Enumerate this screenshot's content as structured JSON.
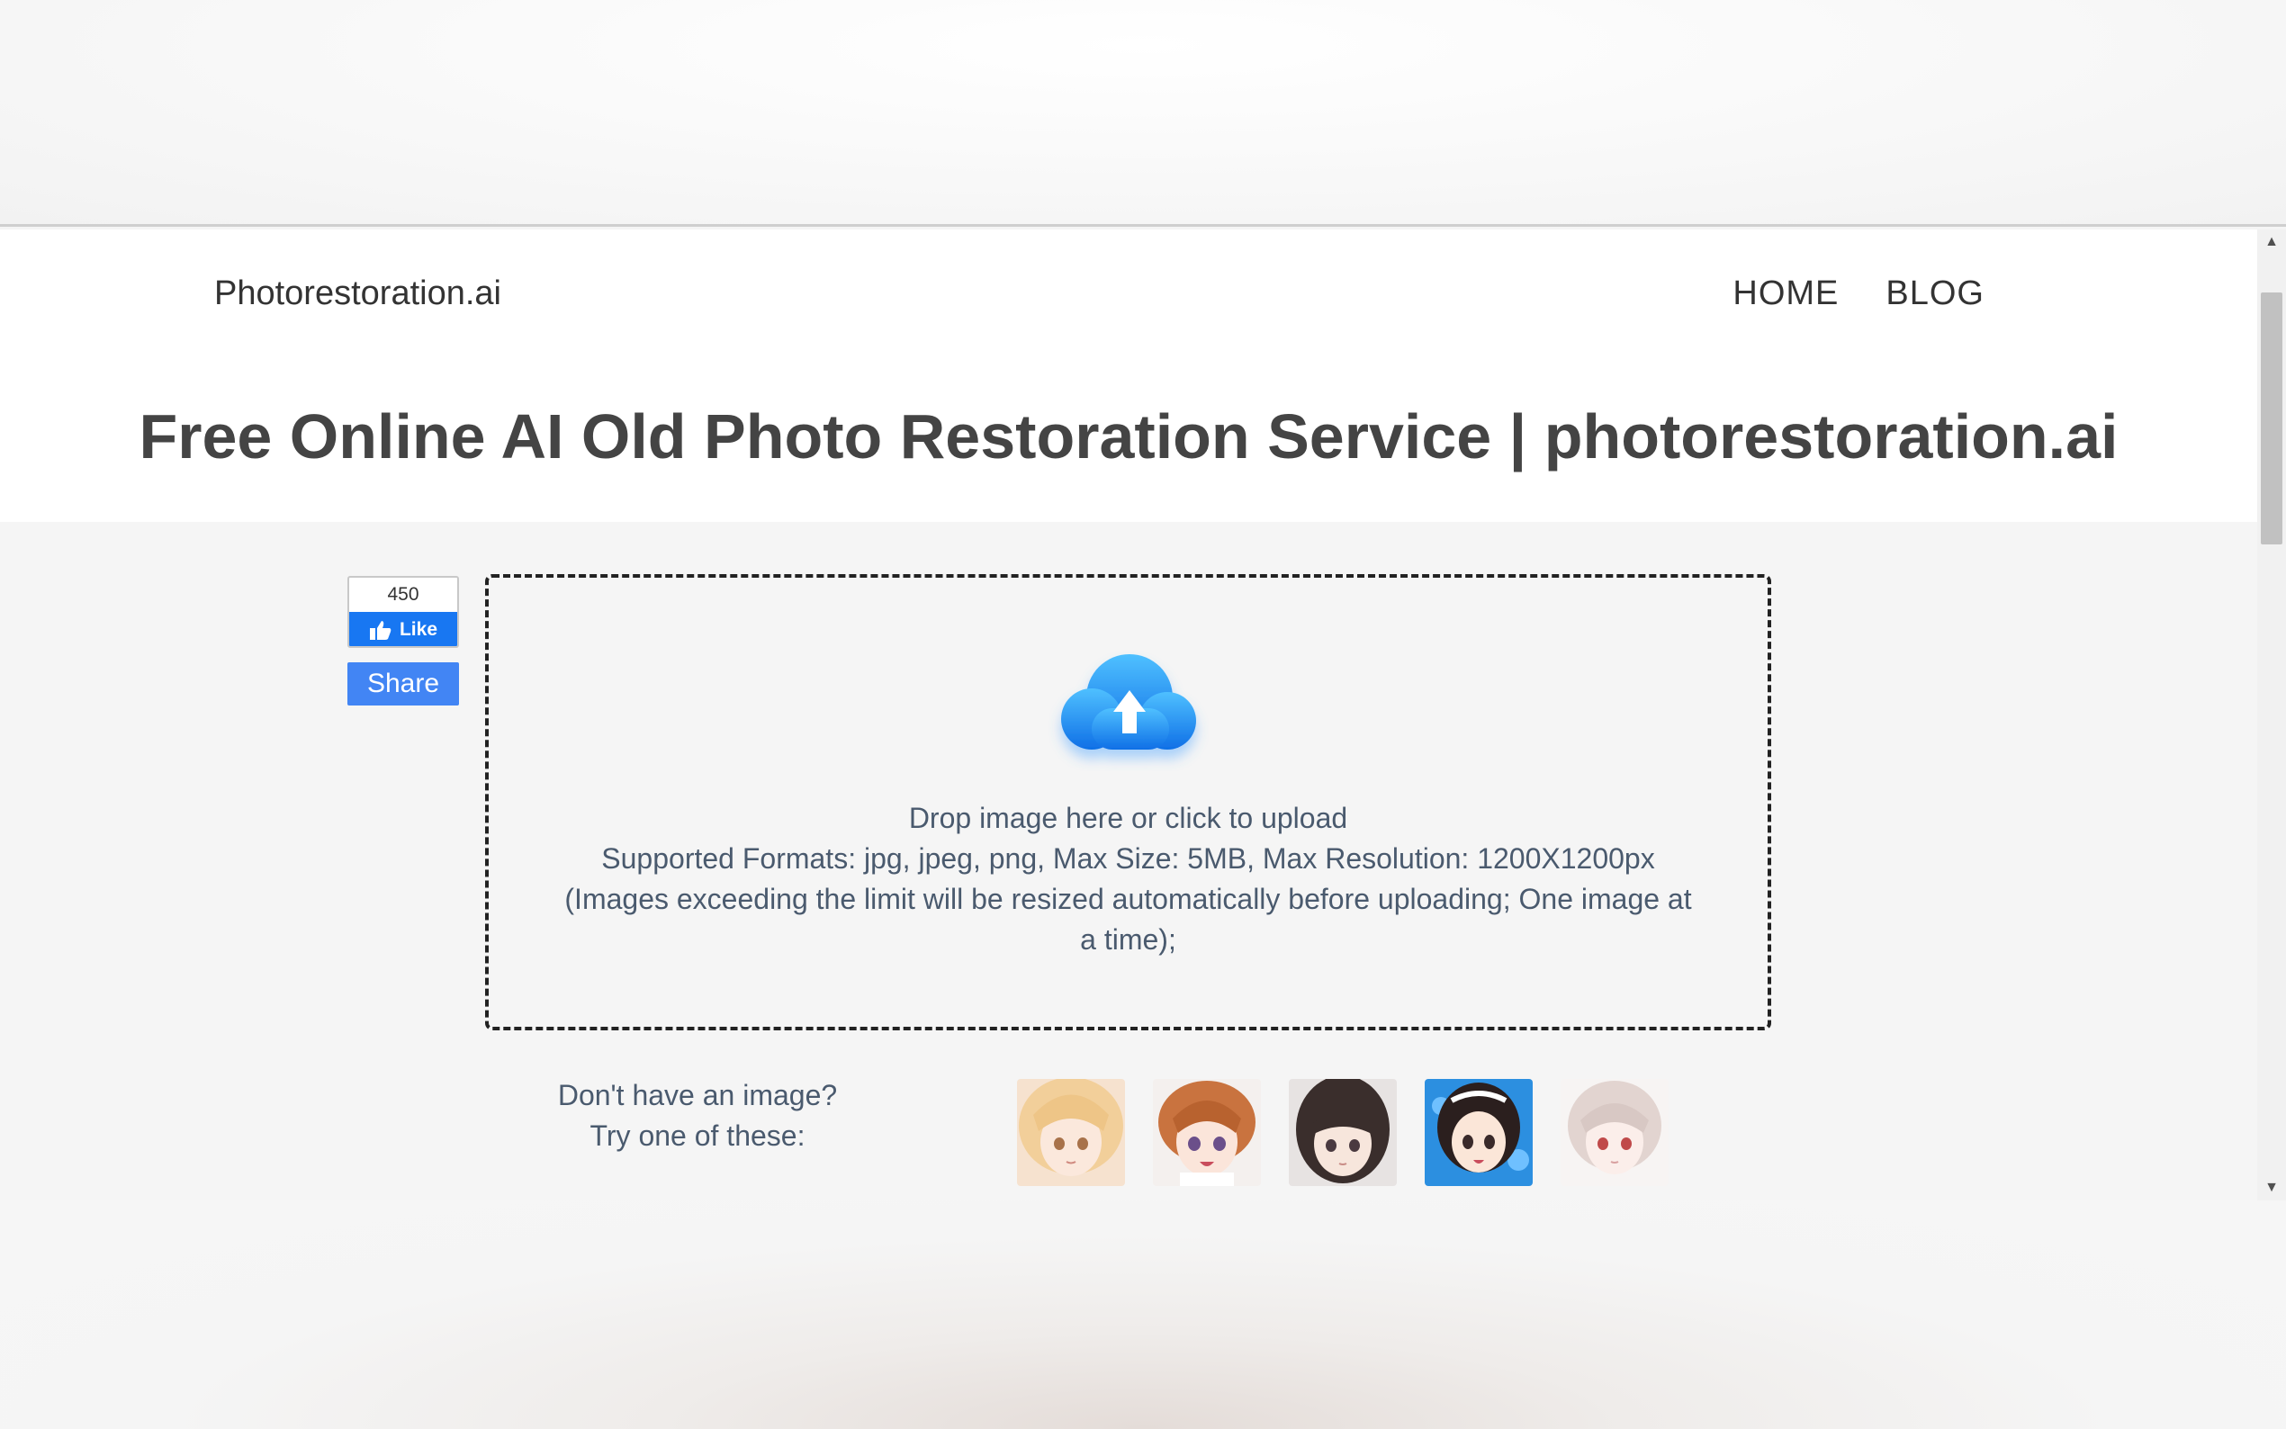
{
  "header": {
    "brand": "Photorestoration.ai",
    "nav": [
      {
        "label": "HOME"
      },
      {
        "label": "BLOG"
      }
    ],
    "title": "Free Online AI Old Photo Restoration Service | photorestoration.ai"
  },
  "social": {
    "like_count": "450",
    "like_label": "Like",
    "share_label": "Share"
  },
  "upload": {
    "icon": "cloud-upload-icon",
    "line1": "Drop image here or click to upload",
    "line2": "Supported Formats: jpg, jpeg, png, Max Size: 5MB, Max Resolution: 1200X1200px",
    "line3": "(Images exceeding the limit will be resized automatically before uploading; One image at a time);"
  },
  "samples": {
    "line1": "Don't have an image?",
    "line2": "Try one of these:",
    "count": 5
  },
  "colors": {
    "brand_blue": "#1877f2",
    "share_blue": "#4285f4",
    "cloud_blue": "#1e8ff0",
    "text": "#4a5a6e"
  }
}
